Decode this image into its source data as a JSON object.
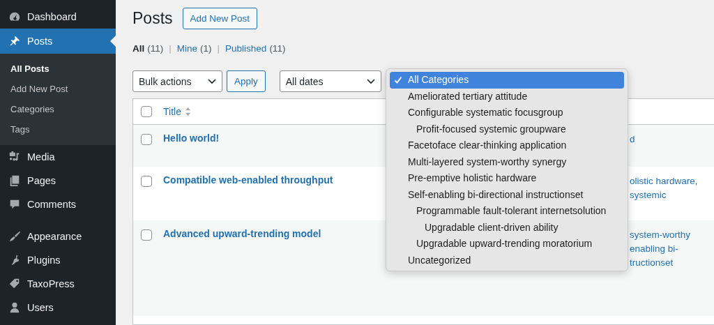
{
  "sidebar": {
    "items": [
      {
        "label": "Dashboard",
        "selected": false
      },
      {
        "label": "Posts",
        "selected": true,
        "children": [
          {
            "label": "All Posts",
            "selected": true
          },
          {
            "label": "Add New Post",
            "selected": false
          },
          {
            "label": "Categories",
            "selected": false
          },
          {
            "label": "Tags",
            "selected": false
          }
        ]
      },
      {
        "label": "Media",
        "selected": false
      },
      {
        "label": "Pages",
        "selected": false
      },
      {
        "label": "Comments",
        "selected": false
      },
      {
        "label": "Appearance",
        "selected": false
      },
      {
        "label": "Plugins",
        "selected": false
      },
      {
        "label": "TaxoPress",
        "selected": false
      },
      {
        "label": "Users",
        "selected": false
      }
    ]
  },
  "page": {
    "title": "Posts",
    "add_button": "Add New Post"
  },
  "views": {
    "separator": "|",
    "items": [
      {
        "label": "All",
        "count": "(11)",
        "selected": true
      },
      {
        "label": "Mine",
        "count": "(1)",
        "selected": false
      },
      {
        "label": "Published",
        "count": "(11)",
        "selected": false
      }
    ]
  },
  "toolbar": {
    "bulk_actions": "Bulk actions",
    "apply": "Apply",
    "dates": "All dates"
  },
  "table": {
    "header_checked": false,
    "title_column": "Title",
    "rows": [
      {
        "title": "Hello world!",
        "checked": false,
        "categories": [
          "d"
        ]
      },
      {
        "title": "Compatible web-enabled throughput",
        "checked": false,
        "categories": [
          "olistic hardware,",
          "systemic"
        ]
      },
      {
        "title": "Advanced upward-trending model",
        "checked": false,
        "categories": [
          "system-worthy",
          "enabling bi-",
          "tructionset"
        ]
      }
    ]
  },
  "category_dropdown": {
    "items": [
      {
        "label": "All Categories",
        "selected": true
      },
      {
        "label": "Ameliorated tertiary attitude",
        "selected": false
      },
      {
        "label": "Configurable systematic focusgroup",
        "selected": false,
        "children": [
          {
            "label": "Profit-focused systemic groupware",
            "selected": false
          }
        ]
      },
      {
        "label": "Facetoface clear-thinking application",
        "selected": false
      },
      {
        "label": "Multi-layered system-worthy synergy",
        "selected": false
      },
      {
        "label": "Pre-emptive holistic hardware",
        "selected": false
      },
      {
        "label": "Self-enabling bi-directional instructionset",
        "selected": false,
        "children": [
          {
            "label": "Programmable fault-tolerant internetsolution",
            "selected": false,
            "children": [
              {
                "label": "Upgradable client-driven ability",
                "selected": false
              }
            ]
          },
          {
            "label": "Upgradable upward-trending moratorium",
            "selected": false
          }
        ]
      },
      {
        "label": "Uncategorized",
        "selected": false
      }
    ]
  }
}
